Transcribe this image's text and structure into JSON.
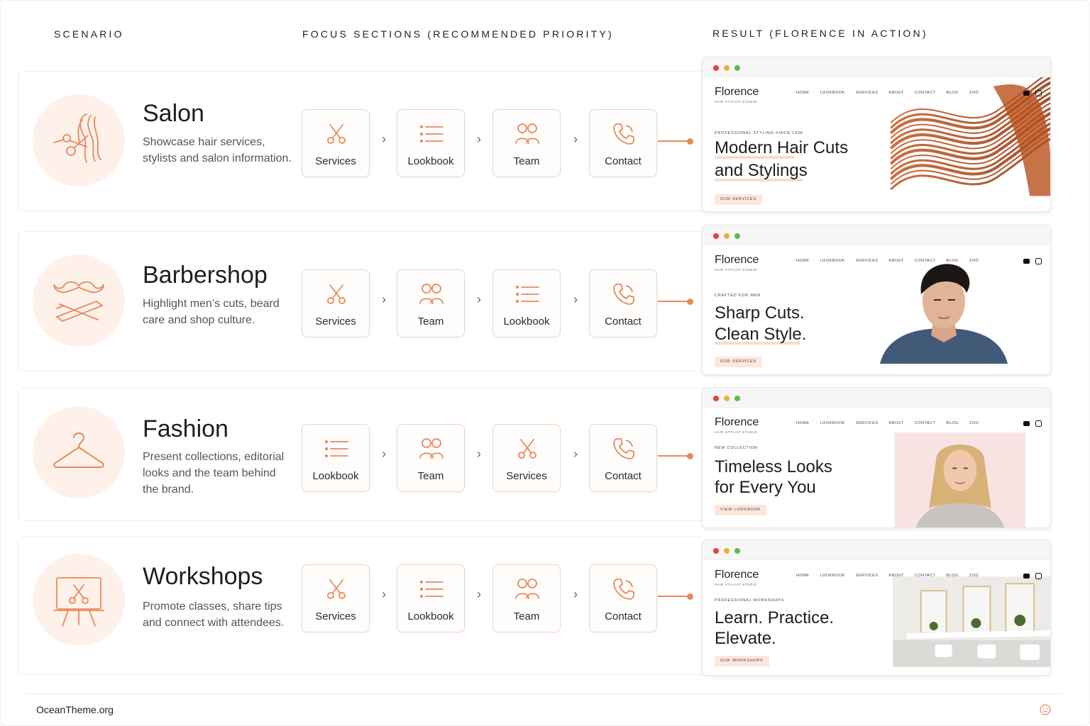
{
  "headers": {
    "scenario": "SCENARIO",
    "focus": "FOCUS SECTIONS (RECOMMENDED PRIORITY)",
    "result": "RESULT (FLORENCE IN ACTION)"
  },
  "nav_items": [
    "HOME",
    "LOOKBOOK",
    "SERVICES",
    "ABOUT",
    "CONTACT",
    "BLOG",
    "ZOO"
  ],
  "brand": {
    "name": "Florence",
    "sub": "HAIR STYLIST STUDIO"
  },
  "accent_color": "#e9885a",
  "rows": [
    {
      "title": "Salon",
      "desc": "Showcase hair services, stylists and salon information.",
      "icon": "scissors-hair-icon",
      "sections": [
        {
          "label": "Services",
          "icon": "scissors"
        },
        {
          "label": "Lookbook",
          "icon": "list"
        },
        {
          "label": "Team",
          "icon": "team"
        },
        {
          "label": "Contact",
          "icon": "phone"
        }
      ],
      "preview": {
        "eyebrow": "PROFESSIONAL STYLING SINCE 1998",
        "line1": "Modern Hair Cuts",
        "line2": "and Stylings",
        "cta": "OUR SERVICES",
        "image": "flowing-hair-image"
      }
    },
    {
      "title": "Barbershop",
      "desc": "Highlight men’s cuts, beard care and shop culture.",
      "icon": "mustache-razor-icon",
      "sections": [
        {
          "label": "Services",
          "icon": "scissors"
        },
        {
          "label": "Team",
          "icon": "team"
        },
        {
          "label": "Lookbook",
          "icon": "list"
        },
        {
          "label": "Contact",
          "icon": "phone"
        }
      ],
      "preview": {
        "eyebrow": "CRAFTED FOR MEN",
        "line1": "Sharp Cuts.",
        "line2": "Clean Style.",
        "cta": "OUR SERVICES",
        "image": "man-portrait-image"
      }
    },
    {
      "title": "Fashion",
      "desc": "Present collections, editorial looks and the team behind the brand.",
      "icon": "hanger-icon",
      "sections": [
        {
          "label": "Lookbook",
          "icon": "list"
        },
        {
          "label": "Team",
          "icon": "team"
        },
        {
          "label": "Services",
          "icon": "scissors"
        },
        {
          "label": "Contact",
          "icon": "phone"
        }
      ],
      "preview": {
        "eyebrow": "NEW COLLECTION",
        "line1": "Timeless Looks",
        "line2": "for Every You",
        "cta": "VIEW LOOKBOOK",
        "image": "woman-portrait-image"
      }
    },
    {
      "title": "Workshops",
      "desc": "Promote classes, share tips and connect with attendees.",
      "icon": "easel-icon",
      "sections": [
        {
          "label": "Services",
          "icon": "scissors"
        },
        {
          "label": "Lookbook",
          "icon": "list"
        },
        {
          "label": "Team",
          "icon": "team"
        },
        {
          "label": "Contact",
          "icon": "phone"
        }
      ],
      "preview": {
        "eyebrow": "PROFESSIONAL WORKSHOPS",
        "line1": "Learn. Practice.",
        "line2": "Elevate.",
        "cta": "OUR WORKSHOPS",
        "image": "salon-interior-image"
      }
    }
  ],
  "footer": {
    "site": "OceanTheme.org"
  }
}
